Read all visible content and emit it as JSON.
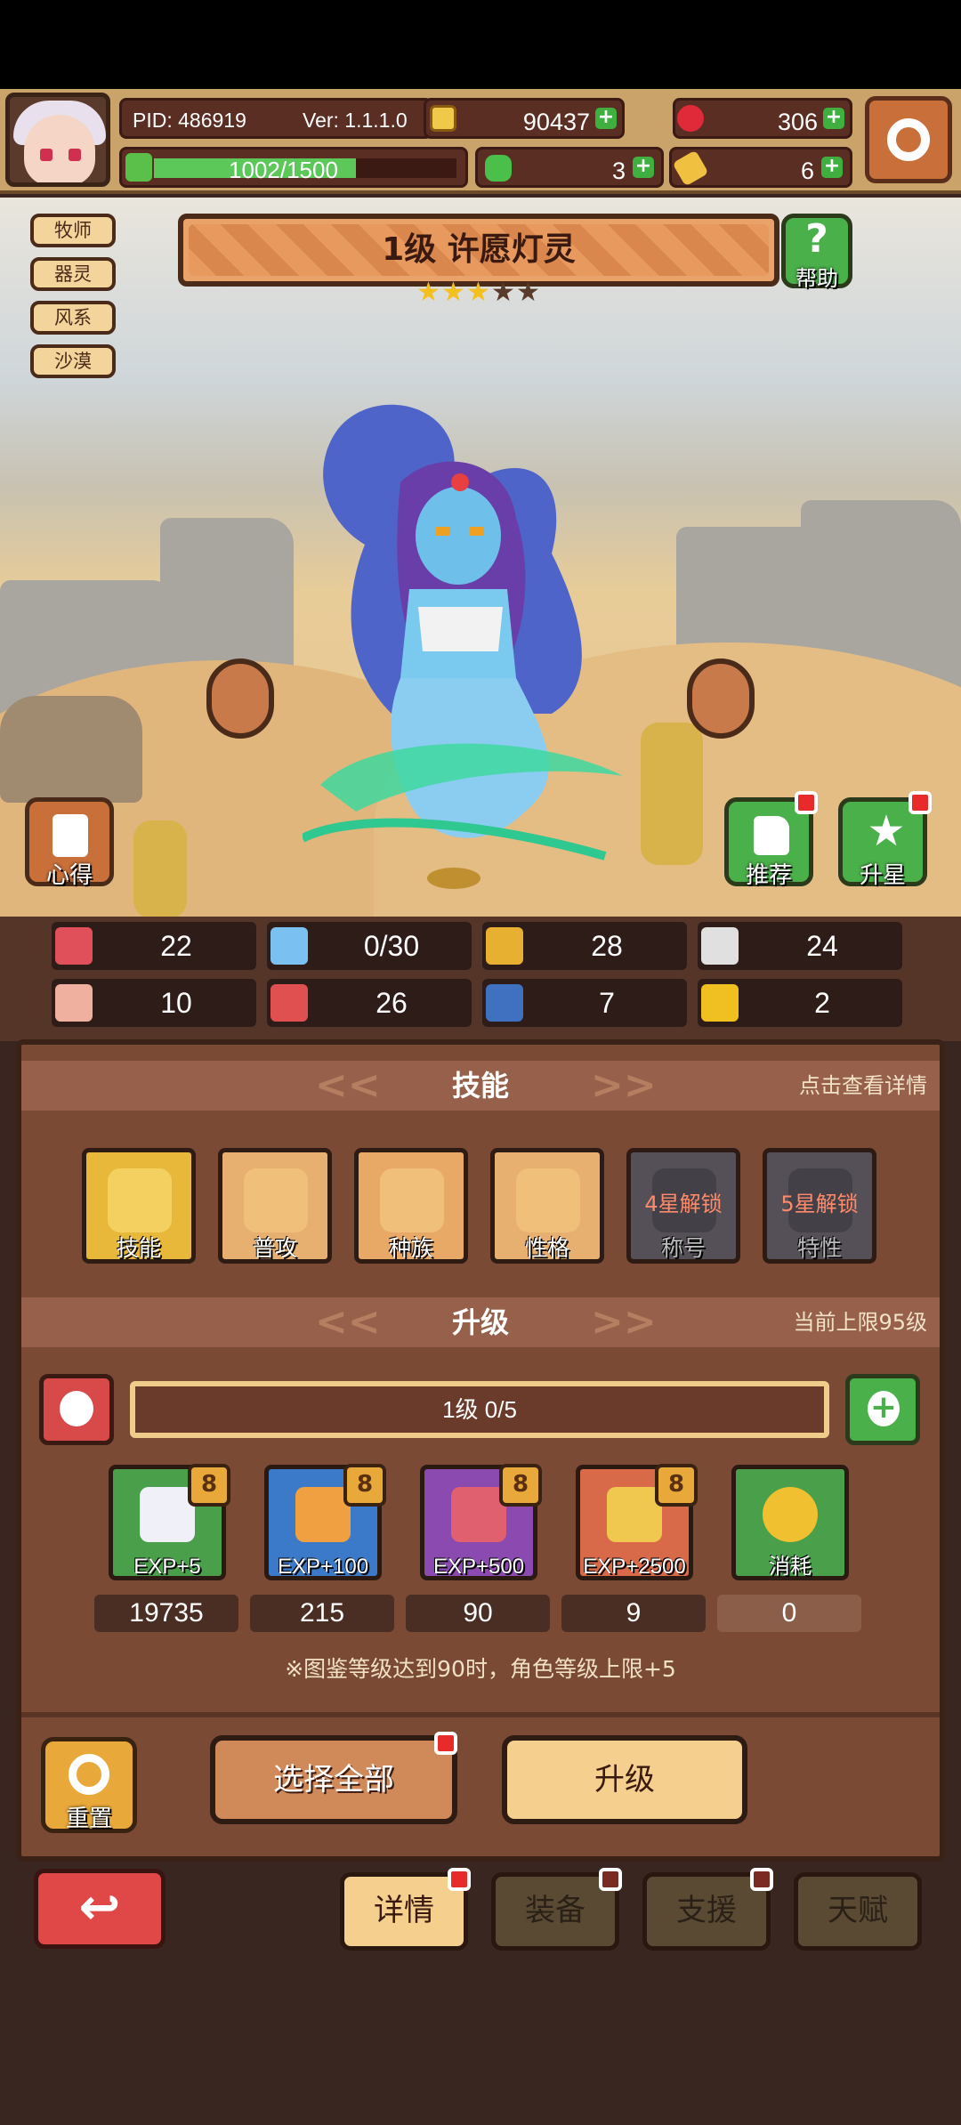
{
  "header": {
    "pid": "PID: 486919",
    "version": "Ver: 1.1.1.0",
    "gold": "90437",
    "gems": "306",
    "energy": "1002/1500",
    "energy_fraction": 0.668,
    "clover": "3",
    "ticket": "6",
    "icons": {
      "gold": "gold-coin-icon",
      "gems": "red-gem-icon",
      "clover": "clover-icon",
      "ticket": "ticket-icon",
      "settings": "gear-icon"
    }
  },
  "character": {
    "tags": [
      "牧师",
      "器灵",
      "风系",
      "沙漠"
    ],
    "title": "1级  许愿灯灵",
    "stars_filled": 3,
    "stars_total": 5,
    "help_label": "帮助",
    "notes_label": "心得",
    "recommend_label": "推荐",
    "star_up_label": "升星"
  },
  "stats": [
    {
      "icon": "heart-icon",
      "value": "22",
      "color": "#e0505a"
    },
    {
      "icon": "water-drop-icon",
      "value": "0/30",
      "color": "#7ac0f0"
    },
    {
      "icon": "shield-icon",
      "value": "28",
      "color": "#e8b030"
    },
    {
      "icon": "boot-icon",
      "value": "24",
      "color": "#e0e0e0"
    },
    {
      "icon": "fist-icon",
      "value": "10",
      "color": "#f0b0a0"
    },
    {
      "icon": "book-icon",
      "value": "26",
      "color": "#e05050"
    },
    {
      "icon": "speed-shoe-icon",
      "value": "7",
      "color": "#4070c0"
    },
    {
      "icon": "horseshoe-icon",
      "value": "2",
      "color": "#f0c020"
    }
  ],
  "skills_section": {
    "title": "技能",
    "hint": "点击查看详情",
    "items": [
      {
        "label": "技能",
        "icon": "gold-heart-icon",
        "locked": ""
      },
      {
        "label": "普攻",
        "icon": "heart-icon",
        "locked": ""
      },
      {
        "label": "种族",
        "icon": "magic-lamp-icon",
        "locked": ""
      },
      {
        "label": "性格",
        "icon": "heart-icon",
        "locked": ""
      },
      {
        "label": "称号",
        "icon": "locked-heart-icon",
        "locked": "4星解锁"
      },
      {
        "label": "特性",
        "icon": "locked-heart-icon",
        "locked": "5星解锁"
      }
    ]
  },
  "upgrade_section": {
    "title": "升级",
    "hint": "当前上限95级",
    "progress_text": "1级  0/5",
    "progress_fraction": 0,
    "items": [
      {
        "label": "EXP+5",
        "count": "19735",
        "icon": "white-crystal-icon",
        "badge": "8"
      },
      {
        "label": "EXP+100",
        "count": "215",
        "icon": "potion-bottle-icon",
        "badge": "8"
      },
      {
        "label": "EXP+500",
        "count": "90",
        "icon": "peach-fruit-icon",
        "badge": "8"
      },
      {
        "label": "EXP+2500",
        "count": "9",
        "icon": "gold-bar-icon",
        "badge": "8"
      },
      {
        "label": "消耗",
        "count": "0",
        "icon": "gold-coin-icon",
        "badge": ""
      }
    ],
    "note": "※图鉴等级达到90时，角色等级上限+5"
  },
  "actions": {
    "reset_label": "重置",
    "select_all_label": "选择全部",
    "upgrade_label": "升级"
  },
  "tabs": [
    "详情",
    "装备",
    "支援",
    "天赋"
  ]
}
